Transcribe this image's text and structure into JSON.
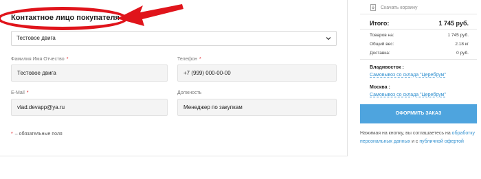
{
  "contact": {
    "title": "Контактное лицо покупателя",
    "profile_select": "Тестовое двига",
    "fields": {
      "name_label": "Фамилия Имя Отчество",
      "name_value": "Тестовое двига",
      "phone_label": "Телефон",
      "phone_value": "+7 (999) 000-00-00",
      "email_label": "E-Mail",
      "email_value": "vlad.devapp@ya.ru",
      "position_label": "Должность",
      "position_value": "Менеджер по закупкам"
    },
    "required_mark": "*",
    "required_note": "– обязательные поля"
  },
  "summary": {
    "download_label": "Скачать корзину",
    "total_label": "Итого:",
    "total_value": "1 745 руб.",
    "rows": [
      {
        "label": "Товаров на:",
        "value": "1 745 руб."
      },
      {
        "label": "Общий вес:",
        "value": "2.18 кг"
      },
      {
        "label": "Доставка:",
        "value": "0 руб."
      }
    ],
    "cities": [
      {
        "name": "Владивосток :",
        "pickup": "Самовывоз со склада \"Церебрум\""
      },
      {
        "name": "Москва :",
        "pickup": "Самовывоз со склада \"Церебрум\""
      }
    ],
    "order_button": "ОФОРМИТЬ ЗАКАЗ",
    "agree_text": "Нажимая на кнопку, вы соглашаетесь на",
    "agree_link1": "обработку персональных данных",
    "agree_and": "и с",
    "agree_link2": "публичной офертой"
  },
  "colors": {
    "accent": "#4ea4de",
    "link": "#2f8fcf",
    "annotation": "#e0141b"
  }
}
